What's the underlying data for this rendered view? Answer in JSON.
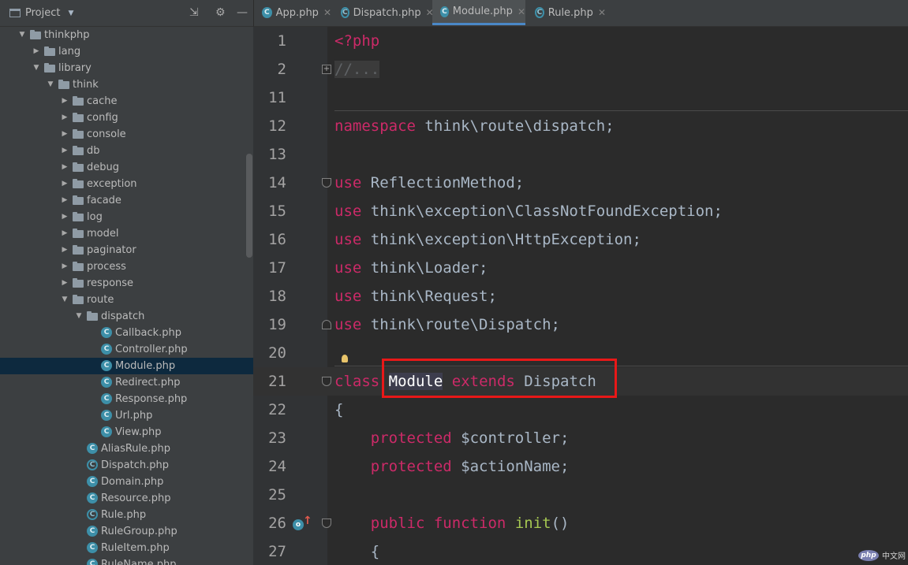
{
  "project_panel": {
    "title": "Project",
    "tree": [
      {
        "label": "thinkphp",
        "type": "folder",
        "depth": 0,
        "expanded": true
      },
      {
        "label": "lang",
        "type": "folder",
        "depth": 1,
        "expanded": false
      },
      {
        "label": "library",
        "type": "folder",
        "depth": 1,
        "expanded": true
      },
      {
        "label": "think",
        "type": "folder",
        "depth": 2,
        "expanded": true
      },
      {
        "label": "cache",
        "type": "folder",
        "depth": 3,
        "expanded": false
      },
      {
        "label": "config",
        "type": "folder",
        "depth": 3,
        "expanded": false
      },
      {
        "label": "console",
        "type": "folder",
        "depth": 3,
        "expanded": false
      },
      {
        "label": "db",
        "type": "folder",
        "depth": 3,
        "expanded": false
      },
      {
        "label": "debug",
        "type": "folder",
        "depth": 3,
        "expanded": false
      },
      {
        "label": "exception",
        "type": "folder",
        "depth": 3,
        "expanded": false
      },
      {
        "label": "facade",
        "type": "folder",
        "depth": 3,
        "expanded": false
      },
      {
        "label": "log",
        "type": "folder",
        "depth": 3,
        "expanded": false
      },
      {
        "label": "model",
        "type": "folder",
        "depth": 3,
        "expanded": false
      },
      {
        "label": "paginator",
        "type": "folder",
        "depth": 3,
        "expanded": false
      },
      {
        "label": "process",
        "type": "folder",
        "depth": 3,
        "expanded": false
      },
      {
        "label": "response",
        "type": "folder",
        "depth": 3,
        "expanded": false
      },
      {
        "label": "route",
        "type": "folder",
        "depth": 3,
        "expanded": true
      },
      {
        "label": "dispatch",
        "type": "folder",
        "depth": 4,
        "expanded": true
      },
      {
        "label": "Callback.php",
        "type": "class",
        "depth": 5
      },
      {
        "label": "Controller.php",
        "type": "class",
        "depth": 5
      },
      {
        "label": "Module.php",
        "type": "class",
        "depth": 5,
        "selected": true
      },
      {
        "label": "Redirect.php",
        "type": "class",
        "depth": 5
      },
      {
        "label": "Response.php",
        "type": "class",
        "depth": 5
      },
      {
        "label": "Url.php",
        "type": "class",
        "depth": 5
      },
      {
        "label": "View.php",
        "type": "class",
        "depth": 5
      },
      {
        "label": "AliasRule.php",
        "type": "class",
        "depth": 4
      },
      {
        "label": "Dispatch.php",
        "type": "abstract",
        "depth": 4
      },
      {
        "label": "Domain.php",
        "type": "class",
        "depth": 4
      },
      {
        "label": "Resource.php",
        "type": "class",
        "depth": 4
      },
      {
        "label": "Rule.php",
        "type": "abstract",
        "depth": 4
      },
      {
        "label": "RuleGroup.php",
        "type": "class",
        "depth": 4
      },
      {
        "label": "RuleItem.php",
        "type": "class",
        "depth": 4
      },
      {
        "label": "RuleName.php",
        "type": "class",
        "depth": 4
      }
    ]
  },
  "tabs": [
    {
      "label": "App.php",
      "icon": "class",
      "active": false
    },
    {
      "label": "Dispatch.php",
      "icon": "abstract",
      "active": false
    },
    {
      "label": "Module.php",
      "icon": "class",
      "active": true
    },
    {
      "label": "Rule.php",
      "icon": "abstract",
      "active": false
    }
  ],
  "editor": {
    "lines": [
      {
        "no": "1",
        "tokens": [
          [
            "kw",
            "<?php"
          ]
        ]
      },
      {
        "no": "2",
        "tokens": [
          [
            "comment-fold",
            "//..."
          ]
        ],
        "fold": "plus"
      },
      {
        "no": "11",
        "tokens": [],
        "separator": true
      },
      {
        "no": "12",
        "tokens": [
          [
            "kw",
            "namespace"
          ],
          [
            "",
            " think\\route\\dispatch;"
          ]
        ]
      },
      {
        "no": "13",
        "tokens": []
      },
      {
        "no": "14",
        "tokens": [
          [
            "kw",
            "use"
          ],
          [
            "",
            " ReflectionMethod;"
          ]
        ],
        "fold": "open"
      },
      {
        "no": "15",
        "tokens": [
          [
            "kw",
            "use"
          ],
          [
            "",
            " think\\exception\\ClassNotFoundException;"
          ]
        ]
      },
      {
        "no": "16",
        "tokens": [
          [
            "kw",
            "use"
          ],
          [
            "",
            " think\\exception\\HttpException;"
          ]
        ]
      },
      {
        "no": "17",
        "tokens": [
          [
            "kw",
            "use"
          ],
          [
            "",
            " think\\Loader;"
          ]
        ]
      },
      {
        "no": "18",
        "tokens": [
          [
            "kw",
            "use"
          ],
          [
            "",
            " think\\Request;"
          ]
        ]
      },
      {
        "no": "19",
        "tokens": [
          [
            "kw",
            "use"
          ],
          [
            "",
            " think\\route\\Dispatch;"
          ]
        ],
        "fold": "close"
      },
      {
        "no": "20",
        "tokens": [],
        "separator": true
      },
      {
        "no": "21",
        "tokens": [
          [
            "kw",
            "class"
          ],
          [
            "",
            " "
          ],
          [
            "hl-class",
            "Module"
          ],
          [
            "",
            " "
          ],
          [
            "kw",
            "extends"
          ],
          [
            "",
            " Dispatch"
          ]
        ],
        "fold": "open",
        "current": true
      },
      {
        "no": "22",
        "tokens": [
          [
            "",
            "{"
          ]
        ]
      },
      {
        "no": "23",
        "tokens": [
          [
            "",
            "    "
          ],
          [
            "kw",
            "protected"
          ],
          [
            "",
            " $controller;"
          ]
        ]
      },
      {
        "no": "24",
        "tokens": [
          [
            "",
            "    "
          ],
          [
            "kw",
            "protected"
          ],
          [
            "",
            " $actionName;"
          ]
        ]
      },
      {
        "no": "25",
        "tokens": []
      },
      {
        "no": "26",
        "tokens": [
          [
            "",
            "    "
          ],
          [
            "kw",
            "public"
          ],
          [
            "",
            " "
          ],
          [
            "kw",
            "function"
          ],
          [
            "",
            " "
          ],
          [
            "fn-green",
            "init"
          ],
          [
            "",
            "()"
          ]
        ],
        "fold": "open",
        "override": true
      },
      {
        "no": "27",
        "tokens": [
          [
            "",
            "    {"
          ]
        ]
      }
    ]
  },
  "watermark": {
    "logo": "php",
    "text": "中文网"
  }
}
